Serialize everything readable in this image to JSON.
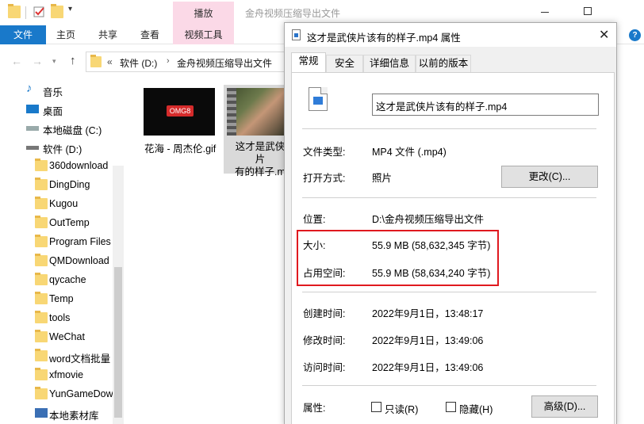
{
  "explorer": {
    "window_title": "金舟视频压缩导出文件",
    "context_tab_header": "播放",
    "ribbon_tabs": [
      "文件",
      "主页",
      "共享",
      "查看",
      "视频工具"
    ],
    "address": {
      "chevron": "«",
      "segments": [
        "软件 (D:)",
        "金舟视频压缩导出文件"
      ]
    },
    "sidebar": [
      {
        "label": "音乐",
        "icon": "music-icon"
      },
      {
        "label": "桌面",
        "icon": "desktop-icon"
      },
      {
        "label": "本地磁盘 (C:)",
        "icon": "drive-icon"
      },
      {
        "label": "软件 (D:)",
        "icon": "drive-icon"
      },
      {
        "label": "360download",
        "icon": "folder-icon"
      },
      {
        "label": "DingDing",
        "icon": "folder-icon"
      },
      {
        "label": "Kugou",
        "icon": "folder-icon"
      },
      {
        "label": "OutTemp",
        "icon": "folder-icon"
      },
      {
        "label": "Program Files",
        "icon": "folder-icon"
      },
      {
        "label": "QMDownload",
        "icon": "folder-icon"
      },
      {
        "label": "qycache",
        "icon": "folder-icon"
      },
      {
        "label": "Temp",
        "icon": "folder-icon"
      },
      {
        "label": "tools",
        "icon": "folder-icon"
      },
      {
        "label": "WeChat",
        "icon": "folder-icon"
      },
      {
        "label": "word文档批量",
        "icon": "folder-icon"
      },
      {
        "label": "xfmovie",
        "icon": "folder-icon"
      },
      {
        "label": "YunGameDow",
        "icon": "folder-icon"
      },
      {
        "label": "本地素材库",
        "icon": "library-icon"
      }
    ],
    "files": [
      {
        "name": "花海 - 周杰伦.gif",
        "thumb_logo": "OMG8"
      },
      {
        "name_line1": "这才是武侠片",
        "name_line2": "有的样子.m"
      }
    ]
  },
  "dialog": {
    "title": "这才是武侠片该有的样子.mp4 属性",
    "tabs": [
      "常规",
      "安全",
      "详细信息",
      "以前的版本"
    ],
    "file_name": "这才是武侠片该有的样子.mp4",
    "file_type_label": "文件类型:",
    "file_type": "MP4 文件 (.mp4)",
    "open_with_label": "打开方式:",
    "open_with": "照片",
    "change_button": "更改(C)...",
    "location_label": "位置:",
    "location": "D:\\金舟视频压缩导出文件",
    "size_label": "大小:",
    "size": "55.9 MB (58,632,345 字节)",
    "size_on_disk_label": "占用空间:",
    "size_on_disk": "55.9 MB (58,634,240 字节)",
    "created_label": "创建时间:",
    "created": "2022年9月1日，13:48:17",
    "modified_label": "修改时间:",
    "modified": "2022年9月1日，13:49:06",
    "accessed_label": "访问时间:",
    "accessed": "2022年9月1日，13:49:06",
    "attributes_label": "属性:",
    "readonly_label": "只读(R)",
    "hidden_label": "隐藏(H)",
    "advanced_button": "高级(D)..."
  },
  "colors": {
    "accent": "#1979ca",
    "highlight_border": "#e0191f",
    "context_tab": "#fbd9e7"
  }
}
